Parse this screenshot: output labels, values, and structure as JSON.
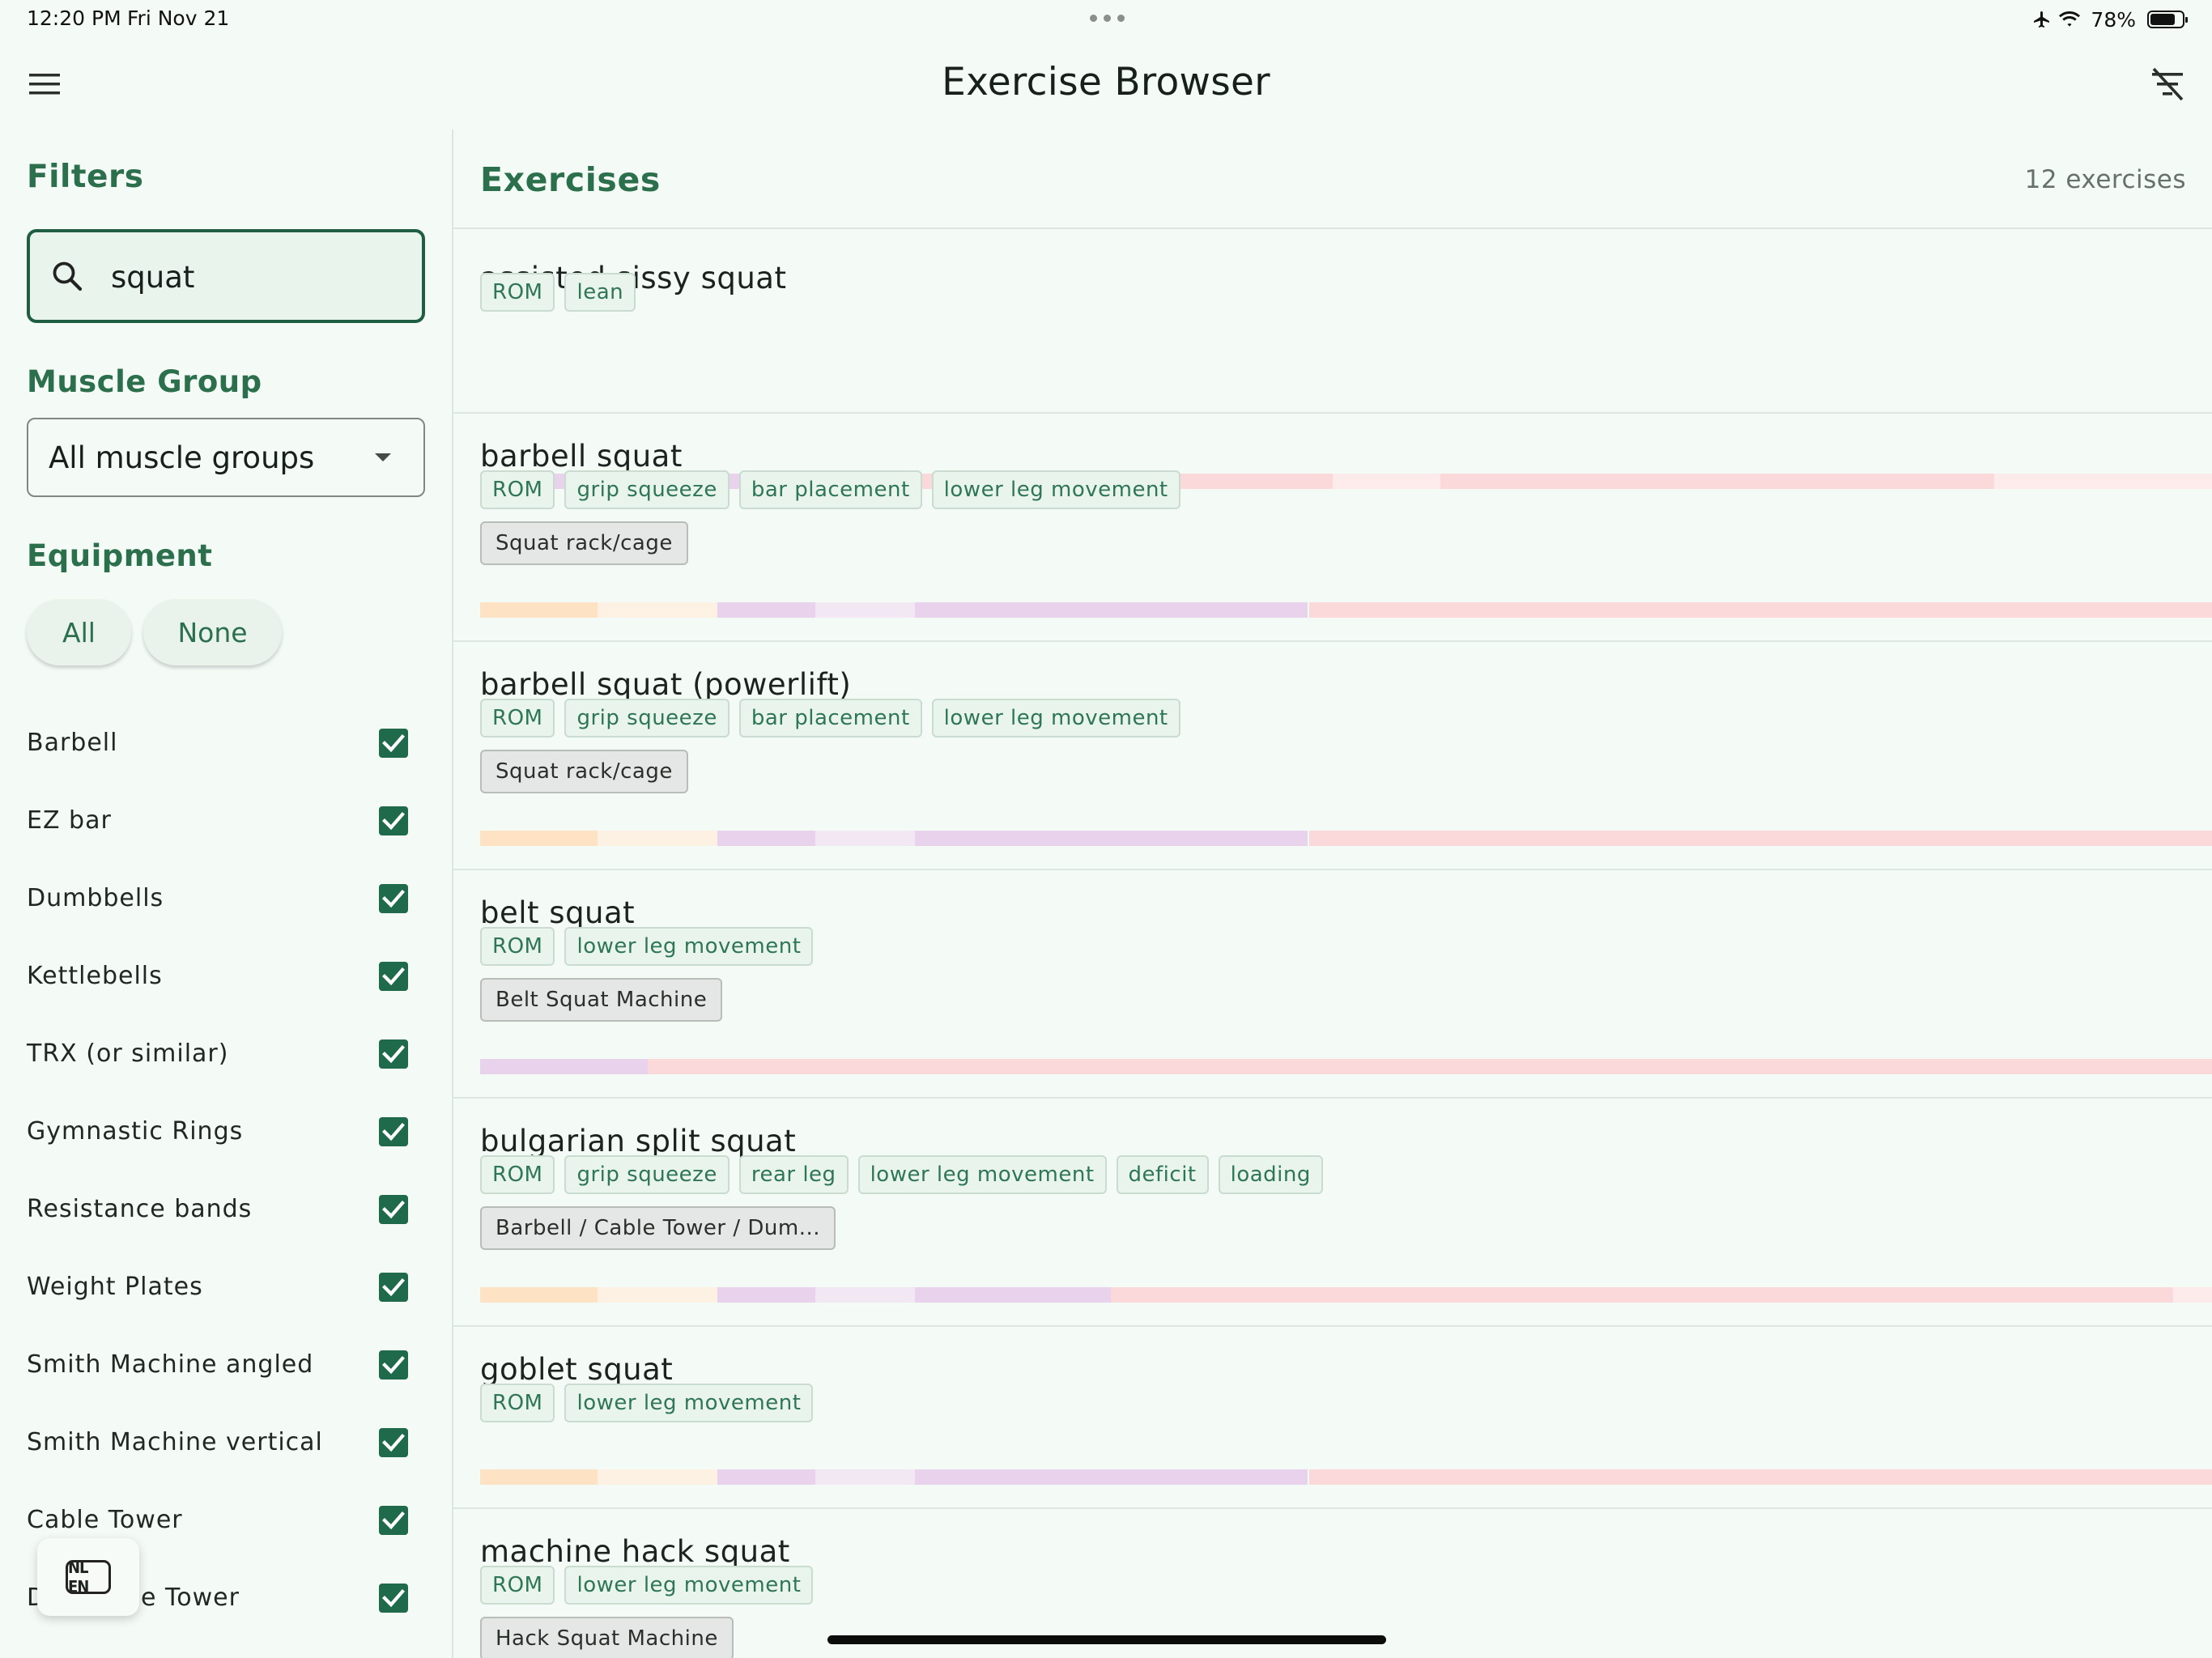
{
  "status_bar": {
    "time": "12:20 PM",
    "date": "Fri Nov 21",
    "battery": "78%",
    "battery_level": 0.78
  },
  "app_bar": {
    "title": "Exercise Browser"
  },
  "sidebar": {
    "filters_title": "Filters",
    "search": {
      "value": "squat",
      "placeholder": ""
    },
    "muscle_group": {
      "title": "Muscle Group",
      "selected": "All muscle groups"
    },
    "equipment": {
      "title": "Equipment",
      "all_label": "All",
      "none_label": "None",
      "items": [
        {
          "label": "Barbell",
          "checked": true
        },
        {
          "label": "EZ bar",
          "checked": true
        },
        {
          "label": "Dumbbells",
          "checked": true
        },
        {
          "label": "Kettlebells",
          "checked": true
        },
        {
          "label": "TRX (or similar)",
          "checked": true
        },
        {
          "label": "Gymnastic Rings",
          "checked": true
        },
        {
          "label": "Resistance bands",
          "checked": true
        },
        {
          "label": "Weight Plates",
          "checked": true
        },
        {
          "label": "Smith Machine angled",
          "checked": true
        },
        {
          "label": "Smith Machine vertical",
          "checked": true
        },
        {
          "label": "Cable Tower",
          "checked": true
        },
        {
          "label": "D",
          "label_tail": "e Tower",
          "checked": true
        }
      ]
    },
    "language_toggle": "NL EN"
  },
  "main": {
    "title": "Exercises",
    "count": "12 exercises",
    "exercises": [
      {
        "name": "assisted sissy squat",
        "tags": [
          "ROM",
          "lean"
        ],
        "equipment": ""
      },
      {
        "name": "barbell squat",
        "tags": [
          "ROM",
          "grip squeeze",
          "bar placement",
          "lower leg movement"
        ],
        "equipment": "Squat rack/cage"
      },
      {
        "name": "barbell squat (powerlift)",
        "tags": [
          "ROM",
          "grip squeeze",
          "bar placement",
          "lower leg movement"
        ],
        "equipment": "Squat rack/cage"
      },
      {
        "name": "belt squat",
        "tags": [
          "ROM",
          "lower leg movement"
        ],
        "equipment": "Belt Squat Machine"
      },
      {
        "name": "bulgarian split squat",
        "tags": [
          "ROM",
          "grip squeeze",
          "rear leg",
          "lower leg movement",
          "deficit",
          "loading"
        ],
        "equipment": "Barbell / Cable Tower / Dum..."
      },
      {
        "name": "goblet squat",
        "tags": [
          "ROM",
          "lower leg movement"
        ],
        "equipment": ""
      },
      {
        "name": "machine hack squat",
        "tags": [
          "ROM",
          "lower leg movement"
        ],
        "equipment": "Hack Squat Machine"
      }
    ]
  },
  "colors": {
    "accent": "#2b6f4c",
    "checkbox": "#1f6a4a",
    "background": "#f4faf5",
    "bar_orange": "#fde3c4",
    "bar_orange_light": "#fdf1e4",
    "bar_purple": "#e9d3ec",
    "bar_purple_light": "#f2e8f4",
    "bar_pink": "#fbd8d9",
    "bar_pink_light": "#fdeaea"
  },
  "icons": {
    "menu": "hamburger-menu-icon",
    "clear_filters": "filter-off-icon",
    "search": "search-icon",
    "dropdown": "chevron-down-icon",
    "checkbox": "checkmark-icon",
    "airplane": "airplane-icon",
    "wifi": "wifi-icon",
    "battery": "battery-icon"
  }
}
